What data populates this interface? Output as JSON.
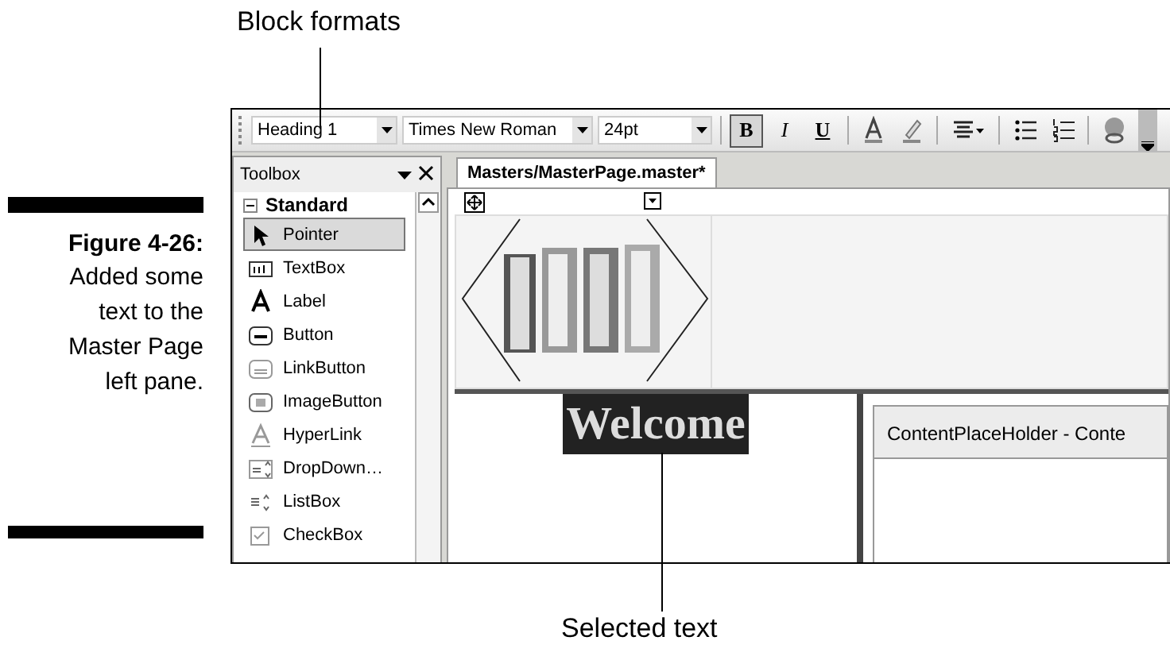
{
  "callout_top": {
    "text": "Block formats"
  },
  "caption": {
    "figure": "Figure 4-26:",
    "text": "Added some text to the Master Page left pane."
  },
  "toolbar": {
    "block_format": "Heading 1",
    "font": "Times New Roman",
    "size": "24pt",
    "buttons": [
      {
        "kind": "text",
        "label": "B",
        "selected": true
      },
      {
        "kind": "text",
        "label": "I",
        "selected": false
      },
      {
        "kind": "text",
        "label": "U",
        "selected": false
      },
      {
        "kind": "font-color",
        "selected": false
      },
      {
        "kind": "highlight",
        "selected": false
      },
      {
        "kind": "align",
        "selected": false
      },
      {
        "kind": "bullets",
        "selected": false
      },
      {
        "kind": "numbering",
        "selected": false
      },
      {
        "kind": "link",
        "selected": false
      }
    ]
  },
  "toolbox": {
    "title": "Toolbox",
    "group": {
      "label": "Standard",
      "expanded": true
    },
    "items": [
      {
        "label": "Pointer",
        "kind": "pointer",
        "selected": true
      },
      {
        "label": "TextBox",
        "kind": "textbox",
        "selected": false
      },
      {
        "label": "Label",
        "kind": "label",
        "selected": false
      },
      {
        "label": "Button",
        "kind": "button",
        "selected": false
      },
      {
        "label": "LinkButton",
        "kind": "linkbutton",
        "selected": false
      },
      {
        "label": "ImageButton",
        "kind": "imagebutton",
        "selected": false
      },
      {
        "label": "HyperLink",
        "kind": "hyperlink",
        "selected": false
      },
      {
        "label": "DropDown…",
        "kind": "dropdown",
        "selected": false
      },
      {
        "label": "ListBox",
        "kind": "listbox",
        "selected": false
      },
      {
        "label": "CheckBox",
        "kind": "checkbox",
        "selected": false
      }
    ]
  },
  "document": {
    "tab": {
      "label": "Masters/MasterPage.master*",
      "selected": true
    },
    "welcome": {
      "text": "Welcome",
      "selected": true
    },
    "placeholder_header": "ContentPlaceHolder - Conte"
  },
  "callout_bottom": {
    "text": "Selected text"
  }
}
